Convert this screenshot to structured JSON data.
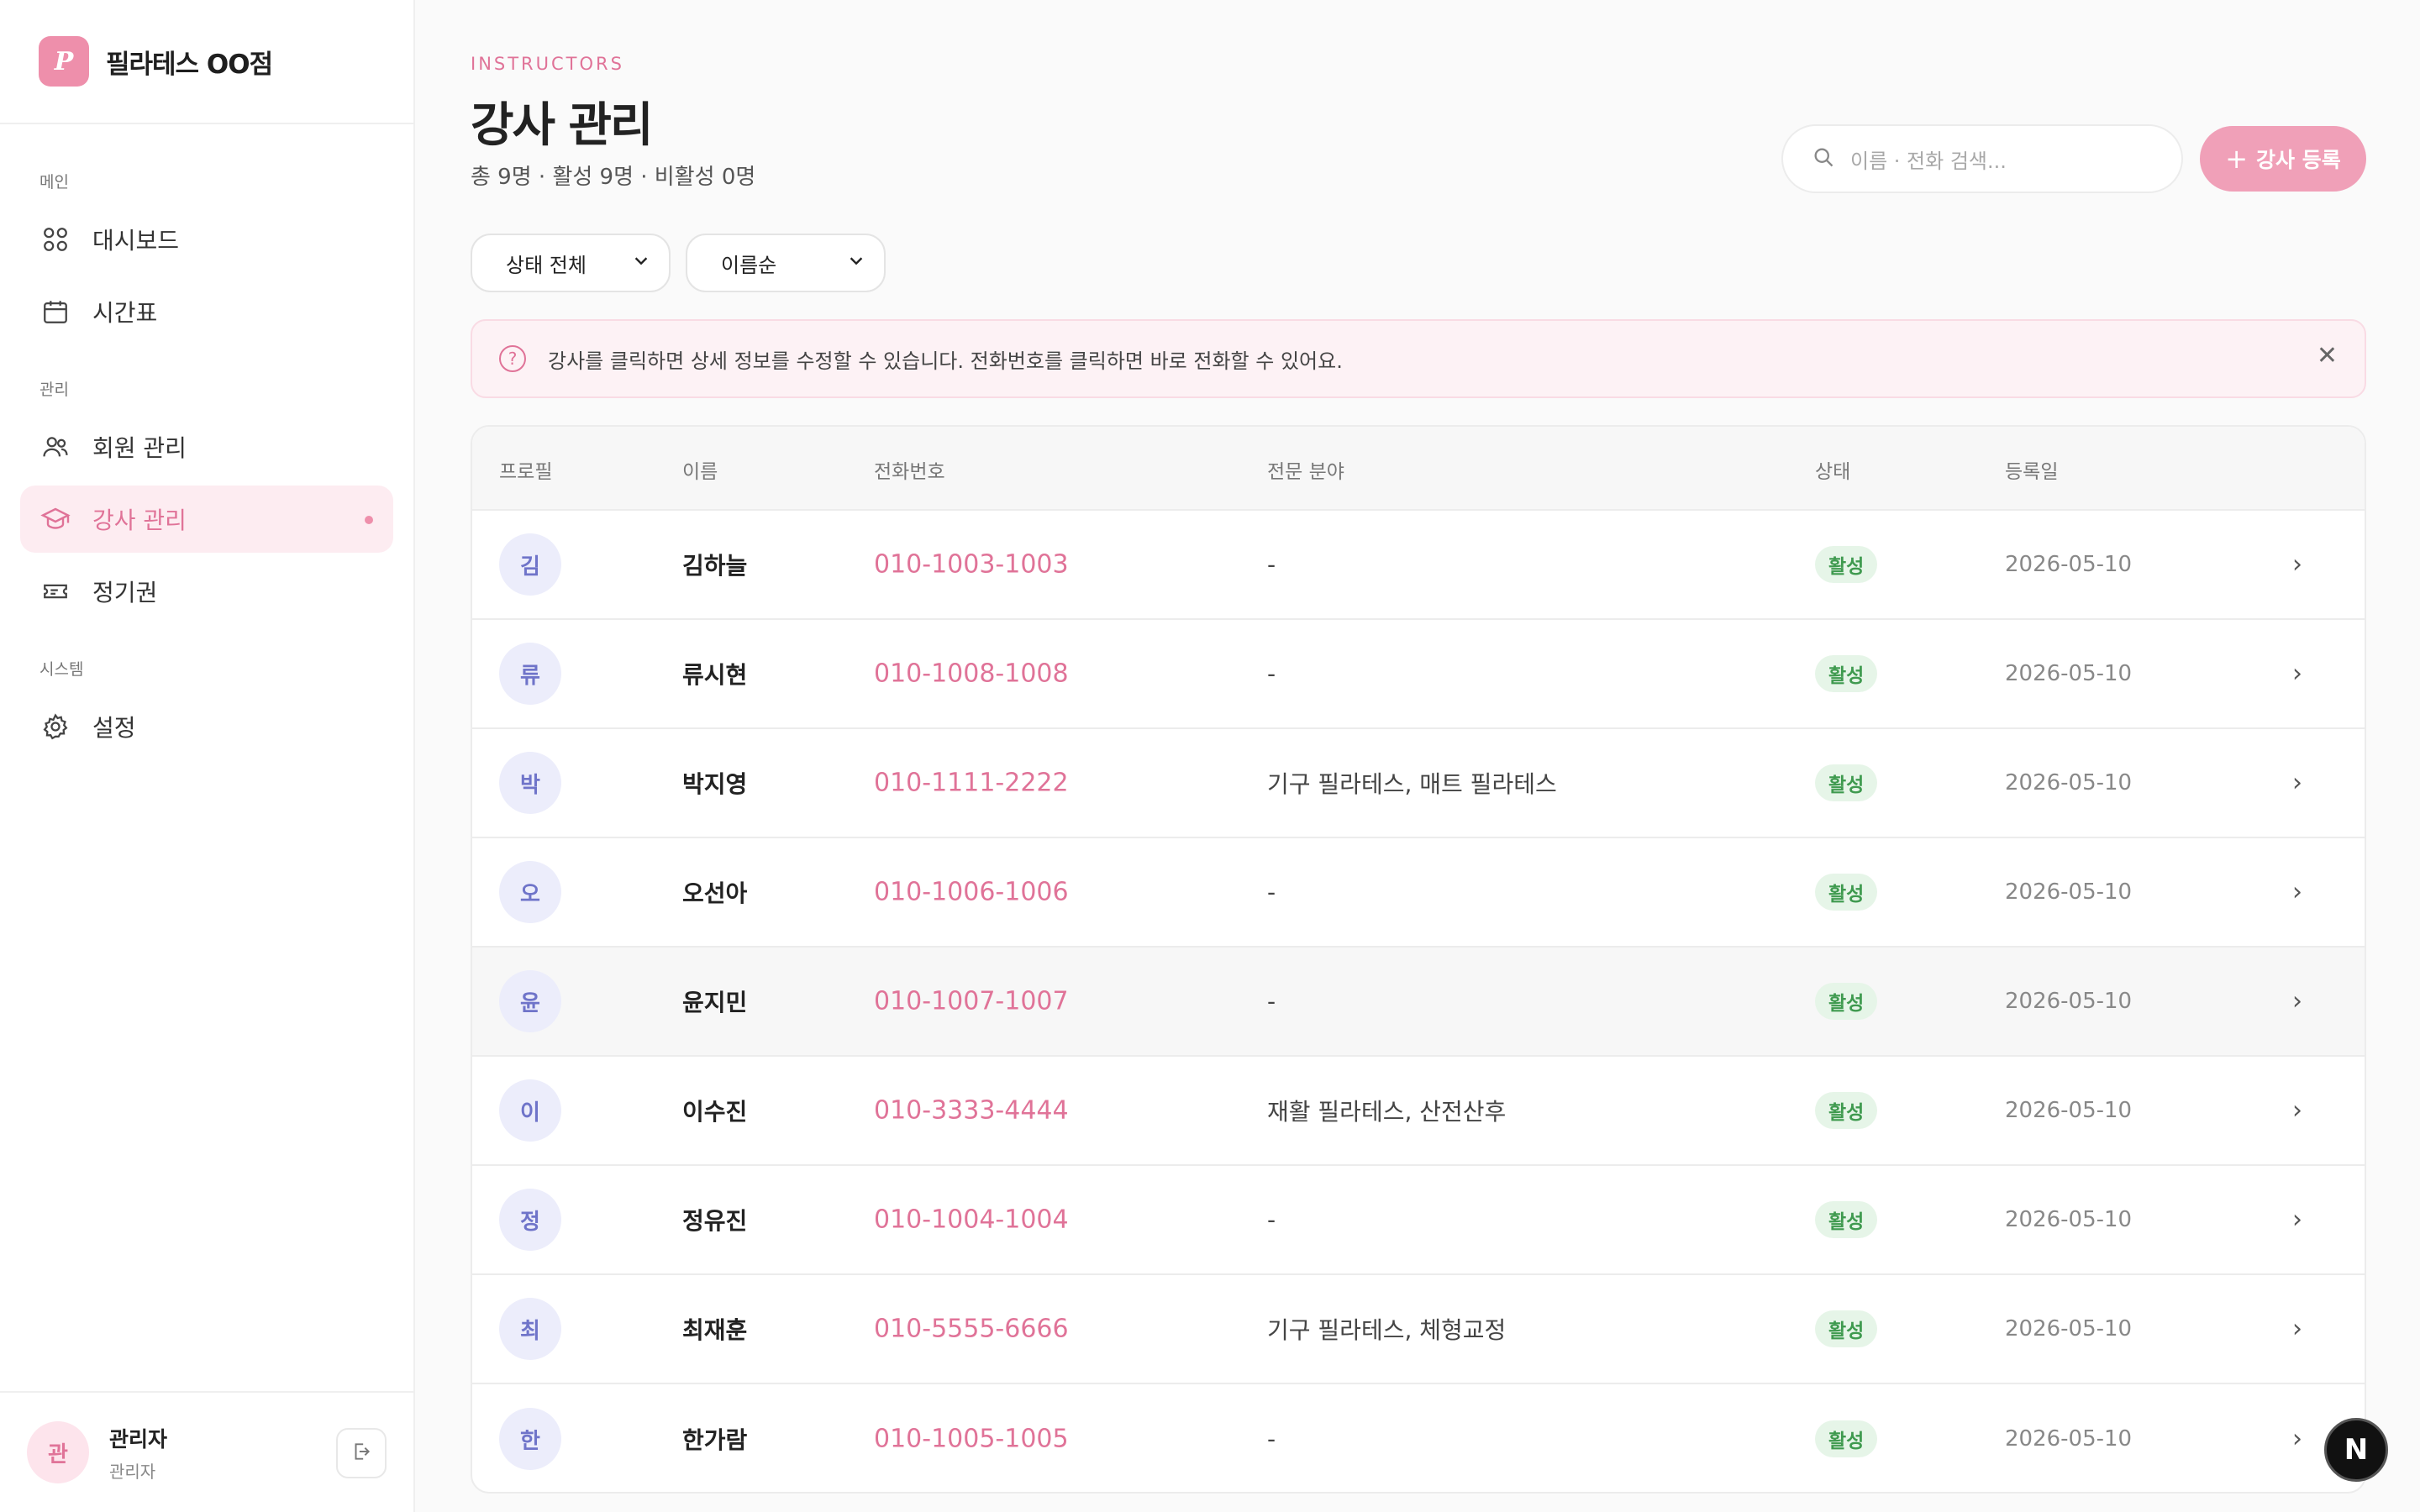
{
  "brand": {
    "logo_letter": "P",
    "name": "필라테스 OO점"
  },
  "sidebar": {
    "sections": [
      {
        "label": "메인",
        "items": [
          {
            "label": "대시보드",
            "icon": "grid-icon"
          },
          {
            "label": "시간표",
            "icon": "calendar-icon"
          }
        ]
      },
      {
        "label": "관리",
        "items": [
          {
            "label": "회원 관리",
            "icon": "users-icon"
          },
          {
            "label": "강사 관리",
            "icon": "graduation-cap-icon",
            "active": true
          },
          {
            "label": "정기권",
            "icon": "ticket-icon"
          }
        ]
      },
      {
        "label": "시스템",
        "items": [
          {
            "label": "설정",
            "icon": "gear-icon"
          }
        ]
      }
    ]
  },
  "user": {
    "avatar_letter": "관",
    "name": "관리자",
    "role": "관리자"
  },
  "header": {
    "eyebrow": "INSTRUCTORS",
    "title": "강사 관리",
    "subtitle": "총 9명 · 활성 9명 · 비활성 0명"
  },
  "search": {
    "placeholder": "이름 · 전화 검색..."
  },
  "add_button": {
    "label": "강사 등록"
  },
  "filters": {
    "status": "상태 전체",
    "sort": "이름순"
  },
  "notice": {
    "text": "강사를 클릭하면 상세 정보를 수정할 수 있습니다. 전화번호를 클릭하면 바로 전화할 수 있어요."
  },
  "table": {
    "columns": [
      "프로필",
      "이름",
      "전화번호",
      "전문 분야",
      "상태",
      "등록일"
    ],
    "rows": [
      {
        "initial": "김",
        "name": "김하늘",
        "phone": "010-1003-1003",
        "specialty": "-",
        "status": "활성",
        "date": "2026-05-10"
      },
      {
        "initial": "류",
        "name": "류시현",
        "phone": "010-1008-1008",
        "specialty": "-",
        "status": "활성",
        "date": "2026-05-10"
      },
      {
        "initial": "박",
        "name": "박지영",
        "phone": "010-1111-2222",
        "specialty": "기구 필라테스, 매트 필라테스",
        "status": "활성",
        "date": "2026-05-10"
      },
      {
        "initial": "오",
        "name": "오선아",
        "phone": "010-1006-1006",
        "specialty": "-",
        "status": "활성",
        "date": "2026-05-10"
      },
      {
        "initial": "윤",
        "name": "윤지민",
        "phone": "010-1007-1007",
        "specialty": "-",
        "status": "활성",
        "date": "2026-05-10",
        "hover": true
      },
      {
        "initial": "이",
        "name": "이수진",
        "phone": "010-3333-4444",
        "specialty": "재활 필라테스, 산전산후",
        "status": "활성",
        "date": "2026-05-10"
      },
      {
        "initial": "정",
        "name": "정유진",
        "phone": "010-1004-1004",
        "specialty": "-",
        "status": "활성",
        "date": "2026-05-10"
      },
      {
        "initial": "최",
        "name": "최재훈",
        "phone": "010-5555-6666",
        "specialty": "기구 필라테스, 체형교정",
        "status": "활성",
        "date": "2026-05-10"
      },
      {
        "initial": "한",
        "name": "한가람",
        "phone": "010-1005-1005",
        "specialty": "-",
        "status": "활성",
        "date": "2026-05-10"
      }
    ]
  },
  "fab": {
    "letter": "N"
  },
  "colors": {
    "accent": "#ee8fab",
    "accent_text": "#e07398",
    "status_active_bg": "#e6f5e8",
    "status_active_text": "#3f9a4f"
  }
}
